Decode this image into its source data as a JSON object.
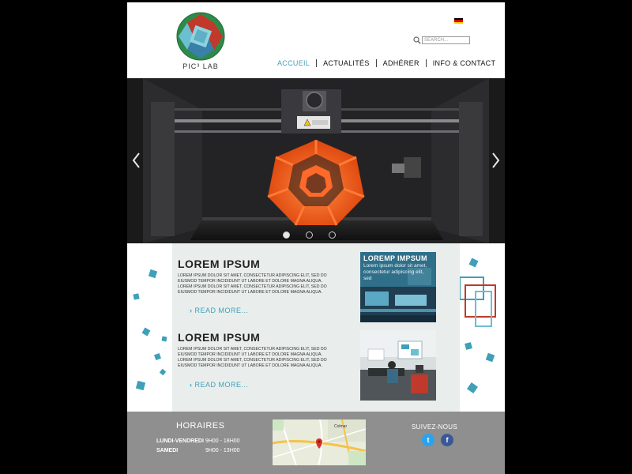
{
  "header": {
    "logo_text": "PIC³ LAB",
    "search_placeholder": "SEARCH...",
    "nav": [
      {
        "label": "ACCUEIL",
        "active": true
      },
      {
        "label": "ACTUALITÉS",
        "active": false
      },
      {
        "label": "ADHÉRER",
        "active": false
      },
      {
        "label": "INFO & CONTACT",
        "active": false
      }
    ],
    "flag_colors": [
      "#000000",
      "#dd0000",
      "#ffce00"
    ]
  },
  "hero": {
    "prev_icon": "chevron-left-icon",
    "next_icon": "chevron-right-icon",
    "printer_label": "WARNING HOT SURFACE",
    "slide_count": 3,
    "active_slide": 0
  },
  "articles": [
    {
      "title": "LOREM IPSUM",
      "text1": "LOREM IPSUM DOLOR SIT AMET, CONSECTETUR ADIPISCING ELIT, SED DO EIUSMOD TEMPOR INCIDIDUNT UT LABORE ET DOLORE MAGNA ALIQUA.",
      "text2": "LOREM IPSUM DOLOR SIT AMET, CONSECTETUR ADIPISCING ELIT, SED DO EIUSMOD TEMPOR INCIDIDUNT UT LABORE ET DOLORE MAGNA ALIQUA.",
      "read_more": "READ MORE...",
      "thumb_title": "LOREMP IMPSUM",
      "thumb_text": "Lorem ipsum dolor sit amet, consectetur adipiscing elit, sed"
    },
    {
      "title": "LOREM IPSUM",
      "text1": "LOREM IPSUM DOLOR SIT AMET, CONSECTETUR ADIPISCING ELIT, SED DO EIUSMOD TEMPOR INCIDIDUNT UT LABORE ET DOLORE MAGNA ALIQUA.",
      "text2": "LOREM IPSUM DOLOR SIT AMET, CONSECTETUR ADIPISCING ELIT, SED DO EIUSMOD TEMPOR INCIDIDUNT UT LABORE ET DOLORE MAGNA ALIQUA.",
      "read_more": "READ MORE..."
    }
  ],
  "footer": {
    "hours_title": "HORAIRES",
    "hours": [
      {
        "day": "LUNDI-VENDREDI",
        "time": "9H00 - 18H00"
      },
      {
        "day": "SAMEDI",
        "time": "9H00 - 13H00"
      }
    ],
    "map_city_label": "Colmar",
    "follow_title": "SUIVEZ-NOUS",
    "twitter_glyph": "t",
    "facebook_glyph": "f"
  },
  "colors": {
    "accent": "#3fa0b8",
    "footer_bg": "#8f8f8f",
    "panel_bg": "#e9eeed",
    "twitter": "#2aa3ef",
    "facebook": "#3b5998",
    "print_orange": "#ff5a1f"
  }
}
